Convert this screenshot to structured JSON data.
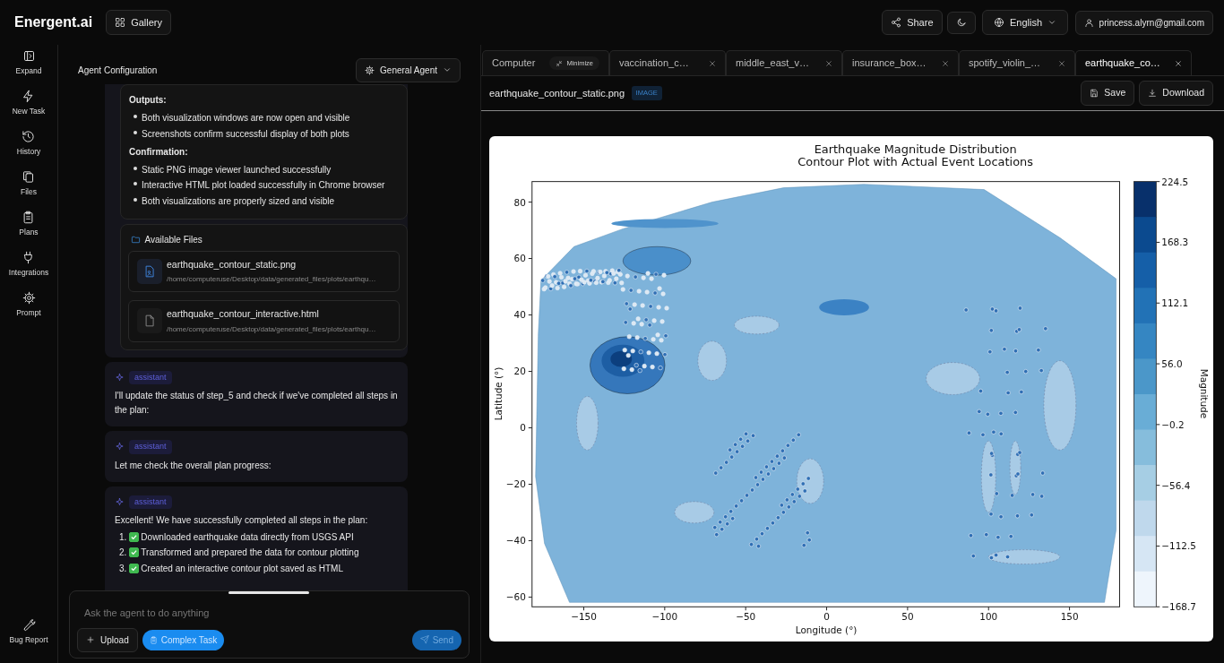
{
  "header": {
    "brand": "Energent.ai",
    "gallery": "Gallery",
    "share": "Share",
    "language": "English",
    "user": "princess.alyrn@gmail.com"
  },
  "sidebar": {
    "items": [
      {
        "label": "Expand"
      },
      {
        "label": "New Task"
      },
      {
        "label": "History"
      },
      {
        "label": "Files"
      },
      {
        "label": "Plans"
      },
      {
        "label": "Integrations"
      },
      {
        "label": "Prompt"
      }
    ],
    "bug_report": "Bug Report"
  },
  "chat": {
    "title": "Agent Configuration",
    "agent": "General Agent",
    "summary_sections": [
      {
        "heading": "Outputs:",
        "items": [
          "Both visualization windows are now open and visible",
          "Screenshots confirm successful display of both plots"
        ]
      },
      {
        "heading": "Confirmation:",
        "items": [
          "Static PNG image viewer launched successfully",
          "Interactive HTML plot loaded successfully in Chrome browser",
          "Both visualizations are properly sized and visible"
        ]
      }
    ],
    "files_title": "Available Files",
    "files": [
      {
        "name": "earthquake_contour_static.png",
        "path": "/home/computeruse/Desktop/data/generated_files/plots/earthqu…",
        "kind": "image"
      },
      {
        "name": "earthquake_contour_interactive.html",
        "path": "/home/computeruse/Desktop/data/generated_files/plots/earthqu…",
        "kind": "document"
      }
    ],
    "messages": [
      {
        "role": "assistant",
        "text": "I'll update the status of step_5 and check if we've completed all steps in the plan:"
      },
      {
        "role": "assistant",
        "text": "Let me check the overall plan progress:"
      },
      {
        "role": "assistant",
        "text": "Excellent! We have successfully completed all steps in the plan:",
        "steps": [
          {
            "number": "1.",
            "text": "Downloaded earthquake data directly from USGS API",
            "done": true
          },
          {
            "number": "2.",
            "text": "Transformed and prepared the data for contour plotting",
            "done": true
          },
          {
            "number": "3.",
            "text": "Created an interactive contour plot saved as HTML",
            "done": true
          }
        ]
      }
    ],
    "input": {
      "placeholder": "Ask the agent to do anything",
      "upload": "Upload",
      "complex_task": "Complex Task",
      "send": "Send",
      "send_disabled": true
    }
  },
  "viewer": {
    "tabs": [
      {
        "label": "Computer",
        "kind": "computer",
        "action": "Minimize",
        "selected": false
      },
      {
        "label": "vaccination_c…",
        "kind": "file",
        "selected": false
      },
      {
        "label": "middle_east_v…",
        "kind": "file",
        "selected": false
      },
      {
        "label": "insurance_box…",
        "kind": "file",
        "selected": false
      },
      {
        "label": "spotify_violin_…",
        "kind": "file",
        "selected": false
      },
      {
        "label": "earthquake_co…",
        "kind": "file",
        "selected": true
      }
    ],
    "file_name": "earthquake_contour_static.png",
    "file_type": "IMAGE",
    "save": "Save",
    "download": "Download",
    "plot": {
      "title": [
        "Earthquake Magnitude Distribution",
        "Contour Plot with Actual Event Locations"
      ],
      "xlabel": "Longitude (°)",
      "ylabel": "Latitude (°)",
      "colorbar_label": "Magnitude",
      "xticks": [
        "−150",
        "−100",
        "−50",
        "0",
        "50",
        "100",
        "150"
      ],
      "yticks": [
        "80",
        "60",
        "40",
        "20",
        "0",
        "−20",
        "−40",
        "−60"
      ],
      "colorbar_ticks": [
        "224.5",
        "168.3",
        "112.1",
        "56.0",
        "−0.2",
        "−56.4",
        "−112.5",
        "−168.7"
      ]
    }
  }
}
